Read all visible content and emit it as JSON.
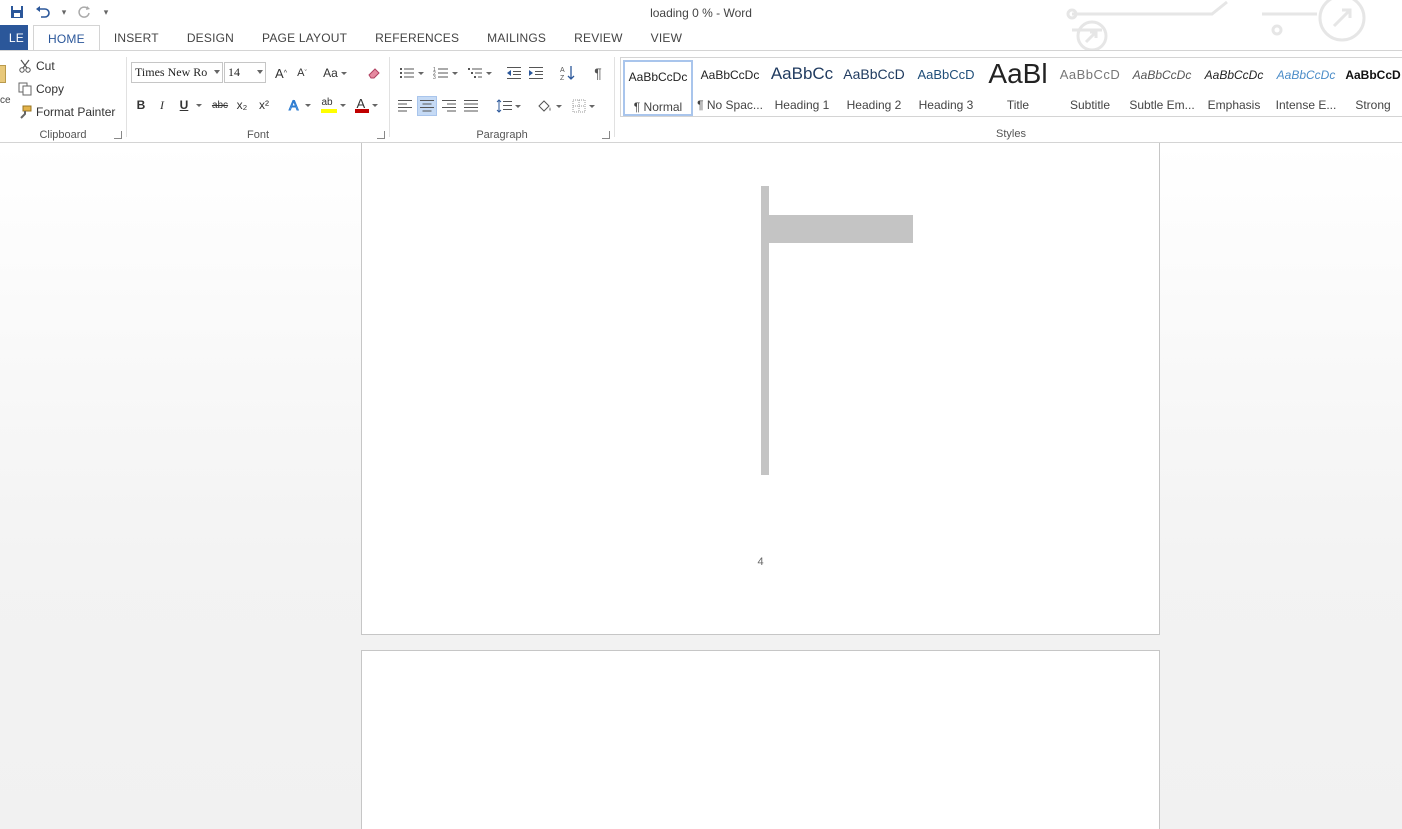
{
  "window": {
    "title": "loading 0 % - Word"
  },
  "tabs": [
    {
      "label": "LE"
    },
    {
      "label": "HOME"
    },
    {
      "label": "INSERT"
    },
    {
      "label": "DESIGN"
    },
    {
      "label": "PAGE LAYOUT"
    },
    {
      "label": "REFERENCES"
    },
    {
      "label": "MAILINGS"
    },
    {
      "label": "REVIEW"
    },
    {
      "label": "VIEW"
    }
  ],
  "clipboard": {
    "paste_label": "ce",
    "cut": "Cut",
    "copy": "Copy",
    "format_painter": "Format Painter",
    "group_label": "Clipboard"
  },
  "font": {
    "family": "Times New Ro",
    "size": "14",
    "change_case": "Aa",
    "bold": "B",
    "italic": "I",
    "underline": "U",
    "strike": "abc",
    "subscript": "x₂",
    "superscript": "x²",
    "group_label": "Font",
    "highlight_color": "#ffff00",
    "font_color": "#c00000"
  },
  "paragraph": {
    "group_label": "Paragraph",
    "pilcrow": "¶"
  },
  "styles": {
    "group_label": "Styles",
    "items": [
      {
        "preview": "AaBbCcDc",
        "name": "¶ Normal"
      },
      {
        "preview": "AaBbCcDc",
        "name": "¶ No Spac..."
      },
      {
        "preview": "AaBbCc",
        "name": "Heading 1"
      },
      {
        "preview": "AaBbCcD",
        "name": "Heading 2"
      },
      {
        "preview": "AaBbCcD",
        "name": "Heading 3"
      },
      {
        "preview": "AaBl",
        "name": "Title"
      },
      {
        "preview": "AaBbCcD",
        "name": "Subtitle"
      },
      {
        "preview": "AaBbCcDc",
        "name": "Subtle Em..."
      },
      {
        "preview": "AaBbCcDc",
        "name": "Emphasis"
      },
      {
        "preview": "AaBbCcDc",
        "name": "Intense E..."
      },
      {
        "preview": "AaBbCcD",
        "name": "Strong"
      }
    ]
  },
  "document": {
    "page_number": "4"
  },
  "colors": {
    "accent": "#2b579a",
    "shape_fill": "#c4c4c4"
  }
}
